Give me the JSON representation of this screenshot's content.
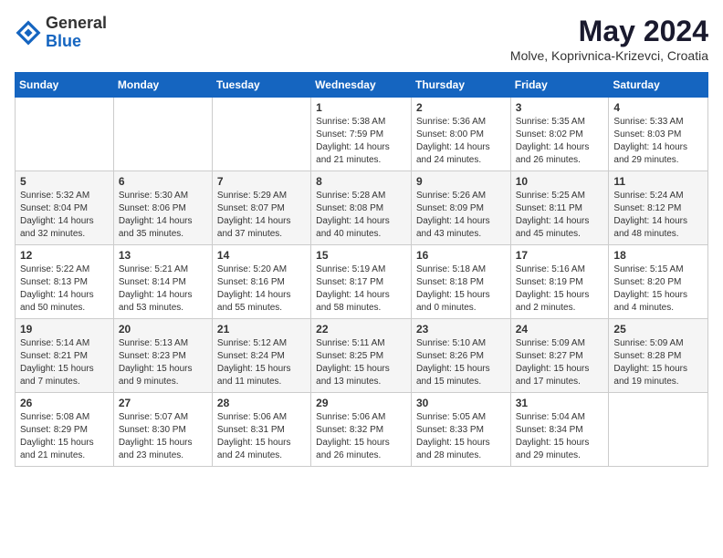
{
  "app": {
    "logo_general": "General",
    "logo_blue": "Blue",
    "month_year": "May 2024",
    "location": "Molve, Koprivnica-Krizevci, Croatia"
  },
  "calendar": {
    "headers": [
      "Sunday",
      "Monday",
      "Tuesday",
      "Wednesday",
      "Thursday",
      "Friday",
      "Saturday"
    ],
    "weeks": [
      [
        {
          "day": "",
          "info": ""
        },
        {
          "day": "",
          "info": ""
        },
        {
          "day": "",
          "info": ""
        },
        {
          "day": "1",
          "info": "Sunrise: 5:38 AM\nSunset: 7:59 PM\nDaylight: 14 hours\nand 21 minutes."
        },
        {
          "day": "2",
          "info": "Sunrise: 5:36 AM\nSunset: 8:00 PM\nDaylight: 14 hours\nand 24 minutes."
        },
        {
          "day": "3",
          "info": "Sunrise: 5:35 AM\nSunset: 8:02 PM\nDaylight: 14 hours\nand 26 minutes."
        },
        {
          "day": "4",
          "info": "Sunrise: 5:33 AM\nSunset: 8:03 PM\nDaylight: 14 hours\nand 29 minutes."
        }
      ],
      [
        {
          "day": "5",
          "info": "Sunrise: 5:32 AM\nSunset: 8:04 PM\nDaylight: 14 hours\nand 32 minutes."
        },
        {
          "day": "6",
          "info": "Sunrise: 5:30 AM\nSunset: 8:06 PM\nDaylight: 14 hours\nand 35 minutes."
        },
        {
          "day": "7",
          "info": "Sunrise: 5:29 AM\nSunset: 8:07 PM\nDaylight: 14 hours\nand 37 minutes."
        },
        {
          "day": "8",
          "info": "Sunrise: 5:28 AM\nSunset: 8:08 PM\nDaylight: 14 hours\nand 40 minutes."
        },
        {
          "day": "9",
          "info": "Sunrise: 5:26 AM\nSunset: 8:09 PM\nDaylight: 14 hours\nand 43 minutes."
        },
        {
          "day": "10",
          "info": "Sunrise: 5:25 AM\nSunset: 8:11 PM\nDaylight: 14 hours\nand 45 minutes."
        },
        {
          "day": "11",
          "info": "Sunrise: 5:24 AM\nSunset: 8:12 PM\nDaylight: 14 hours\nand 48 minutes."
        }
      ],
      [
        {
          "day": "12",
          "info": "Sunrise: 5:22 AM\nSunset: 8:13 PM\nDaylight: 14 hours\nand 50 minutes."
        },
        {
          "day": "13",
          "info": "Sunrise: 5:21 AM\nSunset: 8:14 PM\nDaylight: 14 hours\nand 53 minutes."
        },
        {
          "day": "14",
          "info": "Sunrise: 5:20 AM\nSunset: 8:16 PM\nDaylight: 14 hours\nand 55 minutes."
        },
        {
          "day": "15",
          "info": "Sunrise: 5:19 AM\nSunset: 8:17 PM\nDaylight: 14 hours\nand 58 minutes."
        },
        {
          "day": "16",
          "info": "Sunrise: 5:18 AM\nSunset: 8:18 PM\nDaylight: 15 hours\nand 0 minutes."
        },
        {
          "day": "17",
          "info": "Sunrise: 5:16 AM\nSunset: 8:19 PM\nDaylight: 15 hours\nand 2 minutes."
        },
        {
          "day": "18",
          "info": "Sunrise: 5:15 AM\nSunset: 8:20 PM\nDaylight: 15 hours\nand 4 minutes."
        }
      ],
      [
        {
          "day": "19",
          "info": "Sunrise: 5:14 AM\nSunset: 8:21 PM\nDaylight: 15 hours\nand 7 minutes."
        },
        {
          "day": "20",
          "info": "Sunrise: 5:13 AM\nSunset: 8:23 PM\nDaylight: 15 hours\nand 9 minutes."
        },
        {
          "day": "21",
          "info": "Sunrise: 5:12 AM\nSunset: 8:24 PM\nDaylight: 15 hours\nand 11 minutes."
        },
        {
          "day": "22",
          "info": "Sunrise: 5:11 AM\nSunset: 8:25 PM\nDaylight: 15 hours\nand 13 minutes."
        },
        {
          "day": "23",
          "info": "Sunrise: 5:10 AM\nSunset: 8:26 PM\nDaylight: 15 hours\nand 15 minutes."
        },
        {
          "day": "24",
          "info": "Sunrise: 5:09 AM\nSunset: 8:27 PM\nDaylight: 15 hours\nand 17 minutes."
        },
        {
          "day": "25",
          "info": "Sunrise: 5:09 AM\nSunset: 8:28 PM\nDaylight: 15 hours\nand 19 minutes."
        }
      ],
      [
        {
          "day": "26",
          "info": "Sunrise: 5:08 AM\nSunset: 8:29 PM\nDaylight: 15 hours\nand 21 minutes."
        },
        {
          "day": "27",
          "info": "Sunrise: 5:07 AM\nSunset: 8:30 PM\nDaylight: 15 hours\nand 23 minutes."
        },
        {
          "day": "28",
          "info": "Sunrise: 5:06 AM\nSunset: 8:31 PM\nDaylight: 15 hours\nand 24 minutes."
        },
        {
          "day": "29",
          "info": "Sunrise: 5:06 AM\nSunset: 8:32 PM\nDaylight: 15 hours\nand 26 minutes."
        },
        {
          "day": "30",
          "info": "Sunrise: 5:05 AM\nSunset: 8:33 PM\nDaylight: 15 hours\nand 28 minutes."
        },
        {
          "day": "31",
          "info": "Sunrise: 5:04 AM\nSunset: 8:34 PM\nDaylight: 15 hours\nand 29 minutes."
        },
        {
          "day": "",
          "info": ""
        }
      ]
    ]
  }
}
